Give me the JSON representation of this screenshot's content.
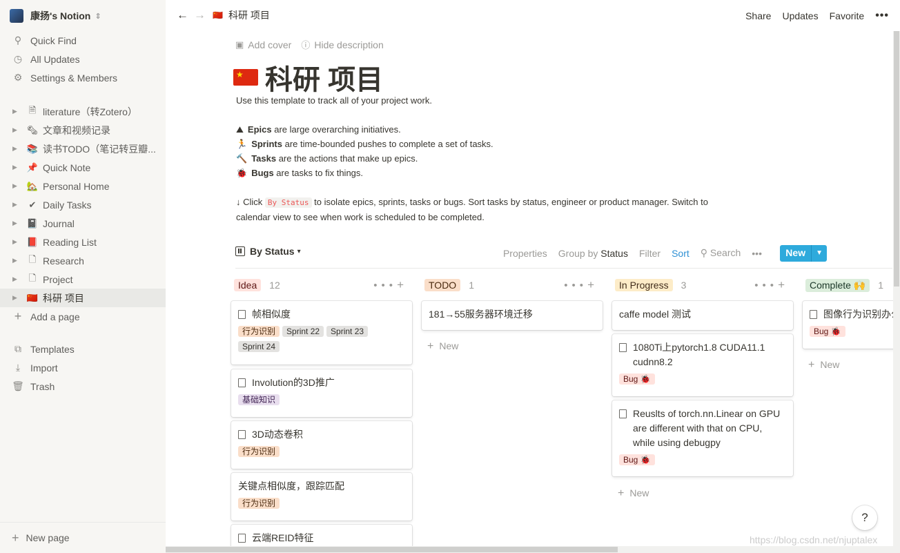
{
  "sidebar": {
    "workspace": "康扬's Notion",
    "nav": [
      {
        "label": "Quick Find",
        "icon": "search-icon",
        "glyph": "⚲"
      },
      {
        "label": "All Updates",
        "icon": "clock-icon",
        "glyph": "◷"
      },
      {
        "label": "Settings & Members",
        "icon": "gear-icon",
        "glyph": "⚙"
      }
    ],
    "pages": [
      {
        "label": "literature（转Zotero）",
        "emoji": "🗎"
      },
      {
        "label": "文章和视频记录",
        "emoji": "🗞"
      },
      {
        "label": "读书TODO（笔记转豆瓣...",
        "emoji": "📚"
      },
      {
        "label": "Quick Note",
        "emoji": "📌"
      },
      {
        "label": "Personal Home",
        "emoji": "🏡"
      },
      {
        "label": "Daily Tasks",
        "emoji": "✔"
      },
      {
        "label": "Journal",
        "emoji": "📓"
      },
      {
        "label": "Reading List",
        "emoji": "📕"
      },
      {
        "label": "Research",
        "emoji": "🗋"
      },
      {
        "label": "Project",
        "emoji": "🗋"
      },
      {
        "label": "科研 项目",
        "emoji": "🇨🇳"
      }
    ],
    "add_page": "Add a page",
    "bottom": [
      {
        "label": "Templates",
        "glyph": "⧉"
      },
      {
        "label": "Import",
        "glyph": "⤓"
      },
      {
        "label": "Trash",
        "glyph": "🗑"
      }
    ],
    "new_page": "New page"
  },
  "topbar": {
    "breadcrumb": "科研 项目",
    "share": "Share",
    "updates": "Updates",
    "favorite": "Favorite",
    "more": "•••"
  },
  "page": {
    "add_cover": "Add cover",
    "hide_description": "Hide description",
    "title": "科研 项目",
    "desc_intro": "Use this template to track all of your project work.",
    "desc_lines": [
      {
        "emoji": "⛰",
        "bold": "Epics",
        "rest": " are large overarching initiatives."
      },
      {
        "emoji": "🏃",
        "bold": "Sprints",
        "rest": " are time-bounded pushes to complete a set of tasks."
      },
      {
        "emoji": "🔨",
        "bold": "Tasks",
        "rest": " are the actions that make up epics."
      },
      {
        "emoji": "🐞",
        "bold": "Bugs",
        "rest": " are tasks to fix things."
      }
    ],
    "click_pre": "↓ Click ",
    "click_code": "By Status",
    "click_post": " to isolate epics, sprints, tasks or bugs. Sort tasks by status, engineer or product manager. Switch to",
    "click_line2": "calendar view to see when work is scheduled to be completed."
  },
  "toolbar": {
    "view": "By Status",
    "properties": "Properties",
    "group_by": "Group by",
    "group_value": "Status",
    "filter": "Filter",
    "sort": "Sort",
    "search": "Search",
    "more": "•••",
    "new": "New"
  },
  "board": {
    "new_label": "New",
    "columns": [
      {
        "name": "Idea",
        "count": "12",
        "bg": "#ffe2dd",
        "fg": "#5d1715",
        "cards": [
          {
            "title": "帧相似度",
            "doc": true,
            "tags": [
              {
                "t": "行为识别",
                "c": "orange"
              },
              {
                "t": "Sprint 22",
                "c": "gray"
              },
              {
                "t": "Sprint 23",
                "c": "gray"
              },
              {
                "t": "Sprint 24",
                "c": "gray"
              }
            ]
          },
          {
            "title": "Involution的3D推广",
            "doc": true,
            "tags": [
              {
                "t": "基础知识",
                "c": "purple"
              }
            ]
          },
          {
            "title": "3D动态卷积",
            "doc": true,
            "tags": [
              {
                "t": "行为识别",
                "c": "orange"
              }
            ]
          },
          {
            "title": "关键点相似度，跟踪匹配",
            "doc": false,
            "tags": [
              {
                "t": "行为识别",
                "c": "orange"
              }
            ]
          },
          {
            "title": "云端REID特征",
            "doc": true,
            "tags": []
          }
        ]
      },
      {
        "name": "TODO",
        "count": "1",
        "bg": "#fadec9",
        "fg": "#49290e",
        "cards": [
          {
            "title": "181→55服务器环境迁移",
            "doc": false,
            "tags": []
          }
        ]
      },
      {
        "name": "In Progress",
        "count": "3",
        "bg": "#fdecc8",
        "fg": "#402c1b",
        "cards": [
          {
            "title": "caffe model 测试",
            "doc": false,
            "tags": []
          },
          {
            "title": "1080Ti上pytorch1.8 CUDA11.1 cudnn8.2",
            "doc": true,
            "tags": [
              {
                "t": "Bug 🐞",
                "c": "red"
              }
            ]
          },
          {
            "title": "Reuslts of torch.nn.Linear on GPU are different with that on CPU, while using debugpy",
            "doc": true,
            "tags": [
              {
                "t": "Bug 🐞",
                "c": "red"
              }
            ]
          }
        ]
      },
      {
        "name": "Complete 🙌",
        "count": "1",
        "bg": "#dbeddb",
        "fg": "#1c3829",
        "cards": [
          {
            "title": "图像行为识别办公",
            "doc": true,
            "tags": [
              {
                "t": "Bug 🐞",
                "c": "red"
              }
            ]
          }
        ]
      }
    ]
  },
  "help": "?",
  "watermark": "https://blog.csdn.net/njuptalex"
}
